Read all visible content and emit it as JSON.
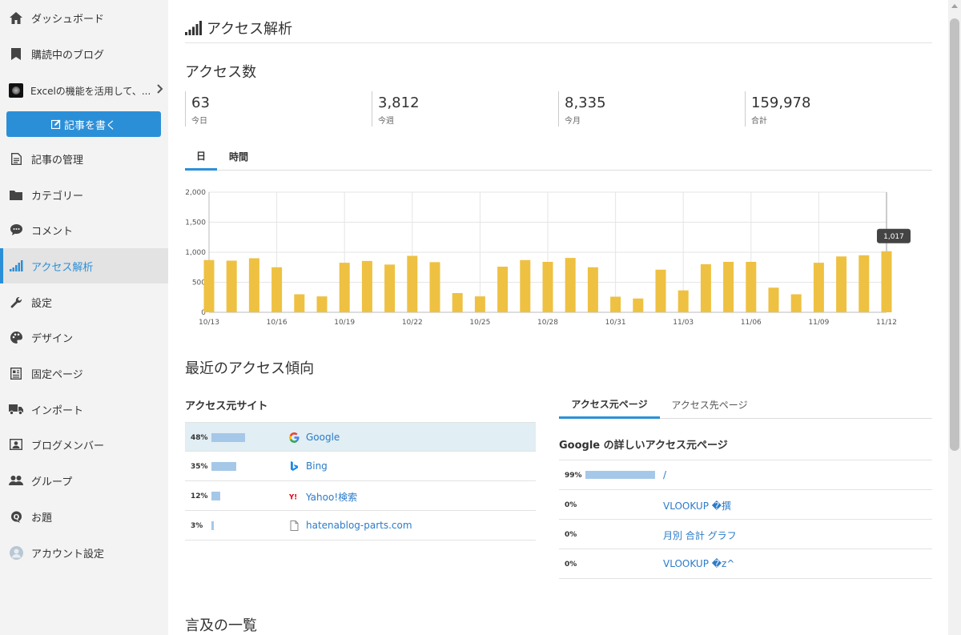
{
  "sidebar": {
    "items": [
      {
        "label": "ダッシュボード",
        "icon": "home-icon"
      },
      {
        "label": "購読中のブログ",
        "icon": "bookmark-icon"
      },
      {
        "label": "記事の管理",
        "icon": "document-icon"
      },
      {
        "label": "カテゴリー",
        "icon": "folder-icon"
      },
      {
        "label": "コメント",
        "icon": "comment-icon"
      },
      {
        "label": "アクセス解析",
        "icon": "signal-bars-icon"
      },
      {
        "label": "設定",
        "icon": "wrench-icon"
      },
      {
        "label": "デザイン",
        "icon": "palette-icon"
      },
      {
        "label": "固定ページ",
        "icon": "page-icon"
      },
      {
        "label": "インポート",
        "icon": "truck-icon"
      },
      {
        "label": "ブログメンバー",
        "icon": "member-icon"
      },
      {
        "label": "グループ",
        "icon": "group-icon"
      },
      {
        "label": "お題",
        "icon": "question-icon"
      },
      {
        "label": "アカウント設定",
        "icon": "avatar-icon"
      }
    ],
    "blog": {
      "label": "Excelの機能を活用して、..."
    },
    "write_button": "記事を書く"
  },
  "header": {
    "title": "アクセス解析"
  },
  "access": {
    "heading": "アクセス数",
    "stats": [
      {
        "value": "63",
        "label": "今日"
      },
      {
        "value": "3,812",
        "label": "今週"
      },
      {
        "value": "8,335",
        "label": "今月"
      },
      {
        "value": "159,978",
        "label": "合計"
      }
    ],
    "tabs": [
      "日",
      "時間"
    ]
  },
  "chart_data": {
    "type": "bar",
    "categories": [
      "10/13",
      "10/14",
      "10/15",
      "10/16",
      "10/17",
      "10/18",
      "10/19",
      "10/20",
      "10/21",
      "10/22",
      "10/23",
      "10/24",
      "10/25",
      "10/26",
      "10/27",
      "10/28",
      "10/29",
      "10/30",
      "10/31",
      "11/01",
      "11/02",
      "11/03",
      "11/04",
      "11/05",
      "11/06",
      "11/07",
      "11/08",
      "11/09",
      "11/10",
      "11/11",
      "11/12"
    ],
    "values": [
      870,
      860,
      900,
      750,
      300,
      265,
      825,
      855,
      795,
      940,
      835,
      320,
      265,
      760,
      870,
      840,
      905,
      750,
      260,
      230,
      710,
      365,
      800,
      840,
      840,
      410,
      300,
      825,
      930,
      950,
      1017
    ],
    "tick_labels": [
      "10/13",
      "10/16",
      "10/19",
      "10/22",
      "10/25",
      "10/28",
      "10/31",
      "11/03",
      "11/06",
      "11/09",
      "11/12"
    ],
    "yticks": [
      "0",
      "500",
      "1,000",
      "1,500",
      "2,000"
    ],
    "ylim": [
      0,
      2000
    ],
    "tooltip": "1,017",
    "bar_color": "#eec142",
    "title": "",
    "xlabel": "",
    "ylabel": ""
  },
  "trends": {
    "heading": "最近のアクセス傾向",
    "sources_heading": "アクセス元サイト",
    "sources": [
      {
        "pct": "48%",
        "fraction": 0.48,
        "name": "Google",
        "icon": "google-icon"
      },
      {
        "pct": "35%",
        "fraction": 0.35,
        "name": "Bing",
        "icon": "bing-icon"
      },
      {
        "pct": "12%",
        "fraction": 0.12,
        "name": "Yahoo!検索",
        "icon": "yahoo-icon"
      },
      {
        "pct": "3%",
        "fraction": 0.03,
        "name": "hatenablog-parts.com",
        "icon": "file-icon"
      }
    ],
    "right_tabs": [
      "アクセス元ページ",
      "アクセス先ページ"
    ],
    "google_heading": "Google の詳しいアクセス元ページ",
    "referrers": [
      {
        "pct": "99%",
        "fraction": 0.99,
        "path": "/"
      },
      {
        "pct": "0%",
        "fraction": 0,
        "path": "VLOOKUP �撰"
      },
      {
        "pct": "0%",
        "fraction": 0,
        "path": "月別 合計 グラフ"
      },
      {
        "pct": "0%",
        "fraction": 0,
        "path": "VLOOKUP �z^"
      }
    ]
  },
  "mentions": {
    "heading": "言及の一覧"
  }
}
